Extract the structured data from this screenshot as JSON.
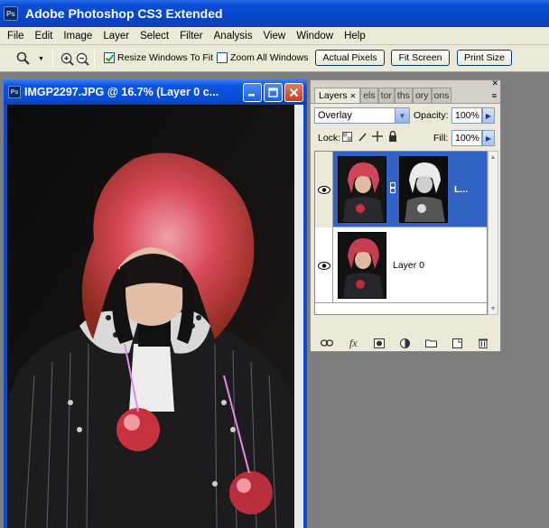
{
  "app": {
    "title": "Adobe Photoshop CS3 Extended",
    "logo": "Ps"
  },
  "menu": [
    "File",
    "Edit",
    "Image",
    "Layer",
    "Select",
    "Filter",
    "Analysis",
    "View",
    "Window",
    "Help"
  ],
  "options": {
    "resize_windows": {
      "label": "Resize Windows To Fit",
      "checked": true
    },
    "zoom_all": {
      "label": "Zoom All Windows",
      "checked": false
    },
    "actual_pixels": "Actual Pixels",
    "fit_screen": "Fit Screen",
    "print_size": "Print Size"
  },
  "document": {
    "title": "IMGP2297.JPG @ 16.7% (Layer 0 c...",
    "icon": "Ps"
  },
  "layers_panel": {
    "tabs": [
      "Layers",
      "els",
      "tor",
      "ths",
      "ory",
      "ons"
    ],
    "blend_mode": "Overlay",
    "opacity_label": "Opacity:",
    "opacity": "100%",
    "lock_label": "Lock:",
    "fill_label": "Fill:",
    "fill": "100%",
    "layers": [
      {
        "name": "L...",
        "selected": true
      },
      {
        "name": "Layer 0",
        "selected": false
      }
    ],
    "footer_icons": [
      "link-icon",
      "fx-icon",
      "mask-icon",
      "adjustment-icon",
      "group-icon",
      "new-layer-icon",
      "trash-icon"
    ]
  },
  "colors": {
    "titlebar": "#0a4bd0",
    "selection": "#3163c5",
    "workspace": "#7d7d7d",
    "chrome": "#ece9d8"
  }
}
